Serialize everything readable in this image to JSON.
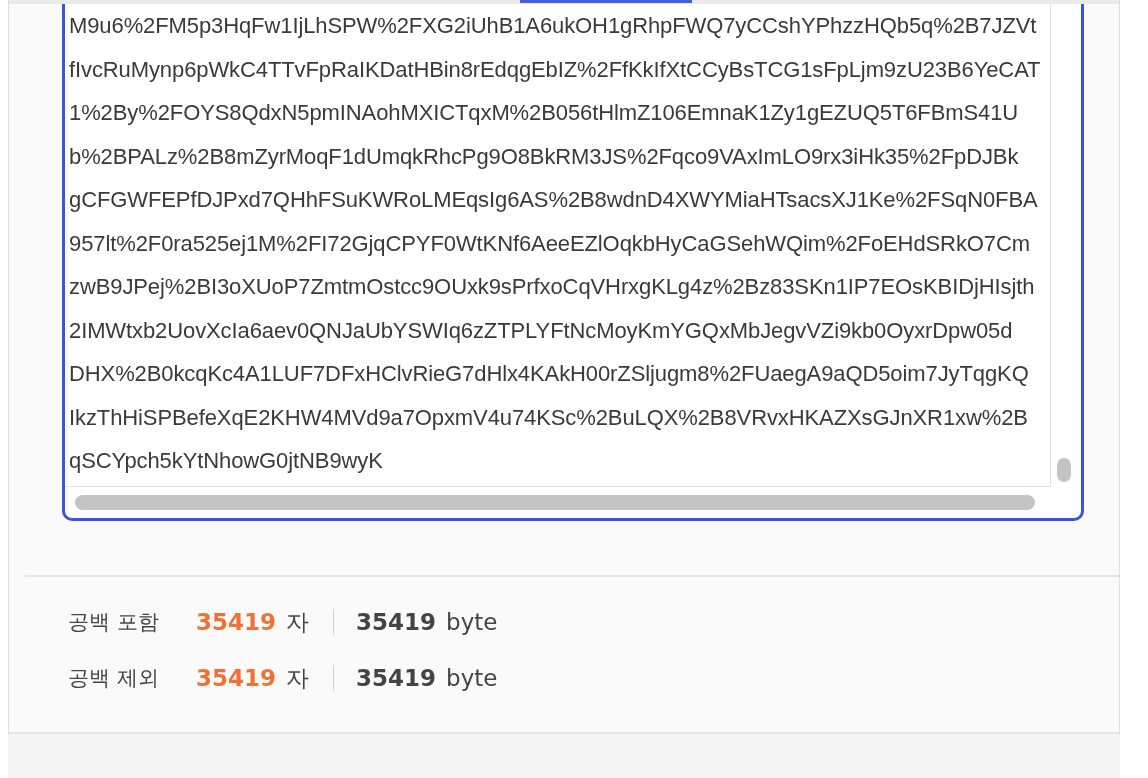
{
  "text_area": {
    "lines": [
      "M9u6%2FM5p3HqFw1IjLhSPW%2FXG2iUhB1A6ukOH1gRhpFWQ7yCCshYPhzzHQb5q%2B7JZVt",
      "fIvcRuMynp6pWkC4TTvFpRaIKDatHBin8rEdqgEbIZ%2FfKkIfXtCCyBsTCG1sFpLjm9zU23B6YeCAT",
      "1%2By%2FOYS8QdxN5pmINAohMXICTqxM%2B056tHlmZ106EmnaK1Zy1gEZUQ5T6FBmS41U",
      "b%2BPALz%2B8mZyrMoqF1dUmqkRhcPg9O8BkRM3JS%2Fqco9VAxImLO9rx3iHk35%2FpDJBk",
      "gCFGWFEPfDJPxd7QHhFSuKWRoLMEqsIg6AS%2B8wdnD4XWYMiaHTsacsXJ1Ke%2FSqN0FBA",
      "957lt%2F0ra525ej1M%2FI72GjqCPYF0WtKNf6AeeEZlOqkbHyCaGSehWQim%2FoEHdSRkO7Cm",
      "zwB9JPej%2BI3oXUoP7ZmtmOstcc9OUxk9sPrfxoCqVHrxgKLg4z%2Bz83SKn1IP7EOsKBIDjHIsjth",
      "2IMWtxb2UovXcIa6aev0QNJaUbYSWIq6zZTPLYFtNcMoyKmYGQxMbJegvVZi9kb0OyxrDpw05d",
      "DHX%2B0kcqKc4A1LUF7DFxHClvRieG7dHlx4KAkH00rZSljugm8%2FUaegA9aQD5oim7JyTqgKQ",
      "IkzThHiSPBefeXqE2KHW4MVd9a7OpxmV4u74KSc%2BuLQX%2B8VRvxHKAZXsGJnXR1xw%2B",
      "qSCYpch5kYtNhowG0jtNB9wyK"
    ]
  },
  "stats": [
    {
      "label": "공백 포함",
      "chars": "35419",
      "char_unit": "자",
      "bytes": "35419",
      "byte_unit": "byte"
    },
    {
      "label": "공백 제외",
      "chars": "35419",
      "char_unit": "자",
      "bytes": "35419",
      "byte_unit": "byte"
    }
  ]
}
